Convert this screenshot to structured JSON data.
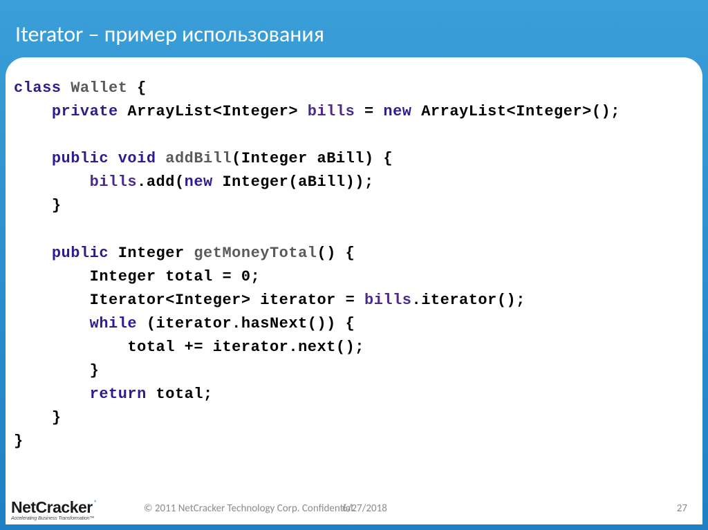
{
  "title": "Iterator – пример использования",
  "code": {
    "l1_kw": "class",
    "l1_name": "Wallet",
    "l1_rest": " {",
    "l2_kw": "private",
    "l2_type": " ArrayList<Integer> ",
    "l2_field": "bills",
    "l2_eq": " = ",
    "l2_kw2": "new",
    "l2_rest": " ArrayList<Integer>();",
    "l4_kw": "public void",
    "l4_name": " addBill",
    "l4_params": "(Integer aBill) {",
    "l5_field": "bills",
    "l5_rest1": ".add(",
    "l5_kw": "new",
    "l5_rest2": " Integer(aBill));",
    "l6": "}",
    "l8_kw": "public",
    "l8_type": " Integer ",
    "l8_name": "getMoneyTotal",
    "l8_rest": "() {",
    "l9": "Integer total = 0;",
    "l10a": "Iterator<Integer> iterator = ",
    "l10_field": "bills",
    "l10b": ".iterator();",
    "l11_kw": "while",
    "l11_rest": " (iterator.hasNext()) {",
    "l12": "total += iterator.next();",
    "l13": "}",
    "l14_kw": "return",
    "l14_rest": " total;",
    "l15": "}",
    "l16": "}"
  },
  "footer": {
    "logo_main": "NetCracker",
    "logo_reg": "®",
    "logo_tag": "Accelerating Business Transformation™",
    "copyright": "© 2011 NetCracker Technology Corp. Confidential.",
    "date": "6/27/2018",
    "page": "27"
  }
}
